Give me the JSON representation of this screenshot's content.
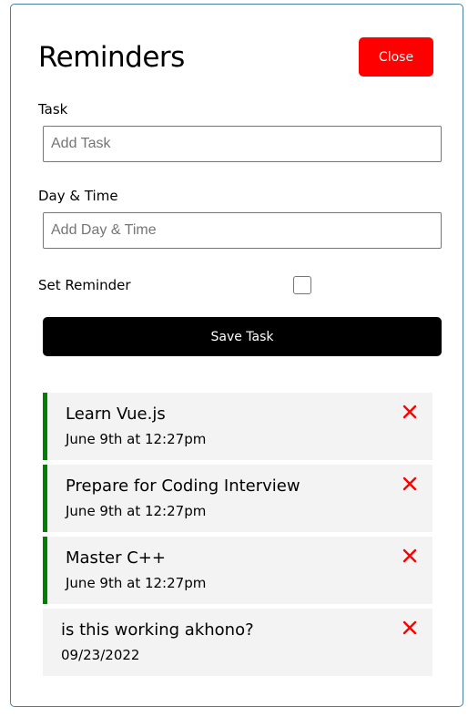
{
  "header": {
    "title": "Reminders",
    "close_label": "Close"
  },
  "form": {
    "task_label": "Task",
    "task_placeholder": "Add Task",
    "day_label": "Day & Time",
    "day_placeholder": "Add Day & Time",
    "reminder_label": "Set Reminder",
    "reminder_checked": false,
    "save_label": "Save Task"
  },
  "tasks": [
    {
      "text": "Learn Vue.js",
      "day": "June 9th at 12:27pm",
      "reminder": true
    },
    {
      "text": "Prepare for Coding Interview",
      "day": "June 9th at 12:27pm",
      "reminder": true
    },
    {
      "text": "Master C++",
      "day": "June 9th at 12:27pm",
      "reminder": true
    },
    {
      "text": "is this working akhono?",
      "day": "09/23/2022",
      "reminder": false
    }
  ],
  "colors": {
    "reminder_border": "#008000",
    "delete": "#ff0000",
    "close_button": "#ff0000",
    "save_button": "#000000"
  }
}
